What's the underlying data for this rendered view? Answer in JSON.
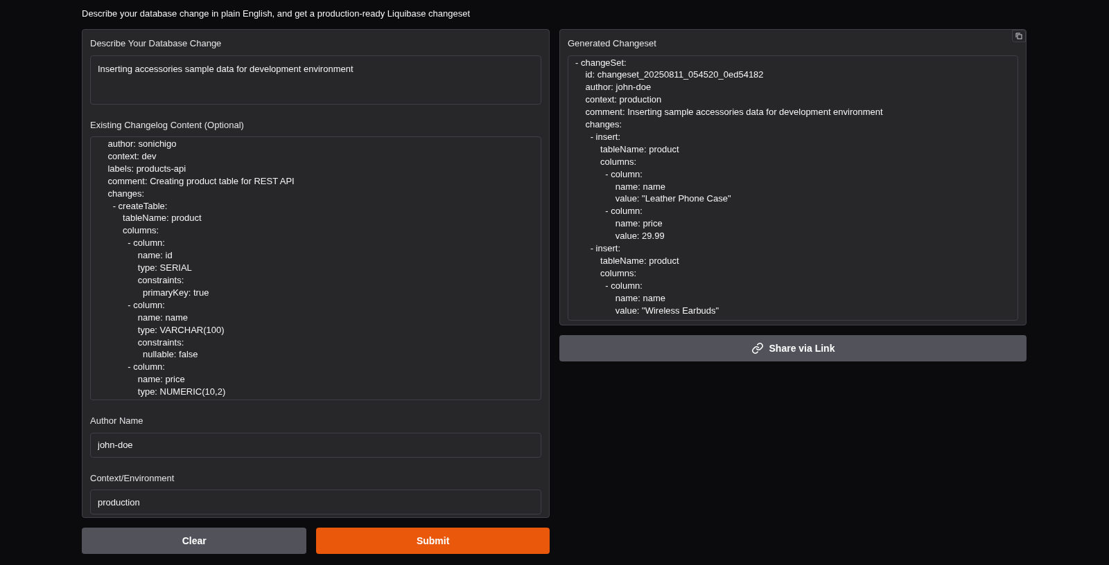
{
  "subtitle": "Describe your database change in plain English, and get a production-ready Liquibase changeset",
  "form": {
    "description": {
      "label": "Describe Your Database Change",
      "value": "Inserting accessories sample data for development environment"
    },
    "changelog": {
      "label": "Existing Changelog Content (Optional)",
      "lines": [
        "    author: sonichigo",
        "    context: dev",
        "    labels: products-api",
        "    comment: Creating product table for REST API",
        "    changes:",
        "      - createTable:",
        "          tableName: product",
        "          columns:",
        "            - column:",
        "                name: id",
        "                type: SERIAL",
        "                constraints:",
        "                  primaryKey: true",
        "            - column:",
        "                name: name",
        "                type: VARCHAR(100)",
        "                constraints:",
        "                  nullable: false",
        "            - column:",
        "                name: price",
        "                type: NUMERIC(10,2)"
      ]
    },
    "author": {
      "label": "Author Name",
      "value": "john-doe"
    },
    "context": {
      "label": "Context/Environment",
      "value": "production"
    }
  },
  "buttons": [
    {
      "label": "Clear",
      "kind": "secondary"
    },
    {
      "label": "Submit",
      "kind": "primary"
    }
  ],
  "output": {
    "label": "Generated Changeset",
    "lines": [
      "- changeSet:",
      "    id: changeset_20250811_054520_0ed54182",
      "    author: john-doe",
      "    context: production",
      "    comment: Inserting sample accessories data for development environment",
      "    changes:",
      "      - insert:",
      "          tableName: product",
      "          columns:",
      "            - column:",
      "                name: name",
      "                value: \"Leather Phone Case\"",
      "            - column:",
      "                name: price",
      "                value: 29.99",
      "      - insert:",
      "          tableName: product",
      "          columns:",
      "            - column:",
      "                name: name",
      "                value: \"Wireless Earbuds\""
    ]
  },
  "share_button": {
    "label": "Share via Link"
  }
}
